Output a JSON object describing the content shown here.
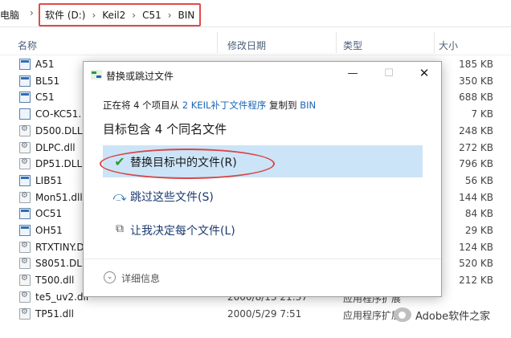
{
  "address": {
    "prefix": "电脑",
    "crumbs": [
      "软件 (D:)",
      "Keil2",
      "C51",
      "BIN"
    ]
  },
  "columns": {
    "name": "名称",
    "date": "修改日期",
    "type": "类型",
    "size": "大小"
  },
  "files": [
    {
      "name": "A51",
      "date": "",
      "type": "",
      "size": "185 KB",
      "icon": "exe"
    },
    {
      "name": "BL51",
      "date": "",
      "type": "",
      "size": "350 KB",
      "icon": "exe"
    },
    {
      "name": "C51",
      "date": "",
      "type": "",
      "size": "688 KB",
      "icon": "exe"
    },
    {
      "name": "CO-KC51.",
      "date": "",
      "type": "",
      "size": "7 KB",
      "icon": "file"
    },
    {
      "name": "D500.DLL",
      "date": "",
      "type": "",
      "size": "248 KB",
      "icon": "dll"
    },
    {
      "name": "DLPC.dll",
      "date": "",
      "type": "",
      "size": "272 KB",
      "icon": "dll"
    },
    {
      "name": "DP51.DLL",
      "date": "",
      "type": "",
      "size": "796 KB",
      "icon": "dll"
    },
    {
      "name": "LIB51",
      "date": "",
      "type": "",
      "size": "56 KB",
      "icon": "exe"
    },
    {
      "name": "Mon51.dll",
      "date": "",
      "type": "",
      "size": "144 KB",
      "icon": "dll"
    },
    {
      "name": "OC51",
      "date": "",
      "type": "",
      "size": "84 KB",
      "icon": "exe"
    },
    {
      "name": "OH51",
      "date": "",
      "type": "",
      "size": "29 KB",
      "icon": "exe"
    },
    {
      "name": "RTXTINY.D",
      "date": "",
      "type": "",
      "size": "124 KB",
      "icon": "dll"
    },
    {
      "name": "S8051.DLL",
      "date": "",
      "type": "",
      "size": "520 KB",
      "icon": "dll"
    },
    {
      "name": "T500.dll",
      "date": "",
      "type": "",
      "size": "212 KB",
      "icon": "dll"
    },
    {
      "name": "te5_uv2.dll",
      "date": "2000/8/13 21:37",
      "type": "应用程序扩展",
      "size": "",
      "icon": "dll"
    },
    {
      "name": "TP51.dll",
      "date": "2000/5/29 7:51",
      "type": "应用程序扩展",
      "size": "",
      "icon": "dll"
    }
  ],
  "dialog": {
    "title": "替换或跳过文件",
    "info_prefix": "正在将 4 个项目从",
    "source": "2 KEIL补丁文件程序",
    "info_mid": "复制到",
    "dest": "BIN",
    "heading": "目标包含 4 个同名文件",
    "options": [
      {
        "icon": "✔",
        "label": "替换目标中的文件(R)"
      },
      {
        "icon": "⤼",
        "label": "跳过这些文件(S)"
      },
      {
        "icon": "⧉",
        "label": "让我决定每个文件(L)"
      }
    ],
    "details": "详细信息"
  },
  "watermark": "Adobe软件之家",
  "colors": {
    "highlight": "#cce4f7",
    "annotation_red": "#e04b4b",
    "link_blue": "#1a66b5",
    "check_green": "#2d9a3a"
  }
}
